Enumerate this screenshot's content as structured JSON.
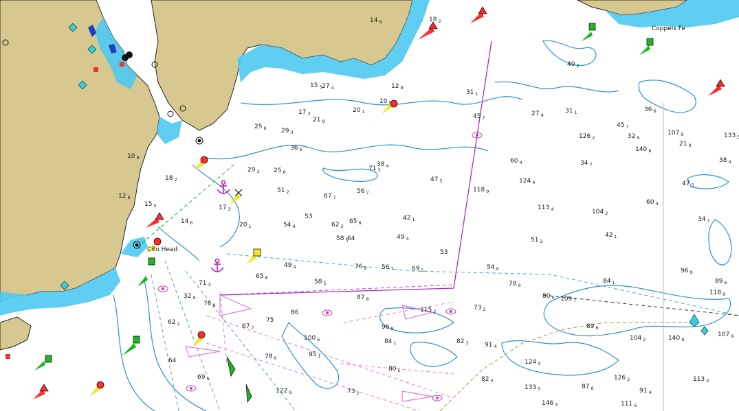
{
  "chart": {
    "place_names": [
      "Cito Head",
      "Coppeis Fe"
    ],
    "colors": {
      "land": "#d7c88f",
      "shallow_water": "#4fc9f2",
      "deep_water": "#ffffff",
      "depth_contour": "#2f8fd6",
      "traffic_lane": "#e07be0",
      "route_line": "#a020c0",
      "cable_line": "#4aa0d8",
      "boundary_line": "#d08030",
      "light_red": "#ff2a2a",
      "light_green": "#1fb81f",
      "light_yellow": "#f4e62a",
      "anchorage": "#c020c0"
    },
    "icons": [
      "anchor-icon",
      "light-flare-icon",
      "buoy-green-icon",
      "buoy-red-icon",
      "buoy-yellow-icon",
      "wreck-icon",
      "radar-beacon-icon"
    ],
    "soundings": [
      {
        "d": "27",
        "s": "4"
      },
      {
        "d": "31",
        "s": "1"
      },
      {
        "d": "45",
        "s": "7"
      },
      {
        "d": "36",
        "s": "6"
      },
      {
        "d": "21",
        "s": "9"
      },
      {
        "d": "38",
        "s": "4"
      },
      {
        "d": "47",
        "s": "5"
      },
      {
        "d": "60",
        "s": "4"
      },
      {
        "d": "34",
        "s": "7"
      },
      {
        "d": "42",
        "s": "1"
      },
      {
        "d": "51",
        "s": "2"
      },
      {
        "d": "54",
        "s": "9"
      },
      {
        "d": "53",
        "s": ""
      },
      {
        "d": "56",
        "s": "7"
      },
      {
        "d": "58",
        "s": "5"
      },
      {
        "d": "49",
        "s": "4"
      },
      {
        "d": "65",
        "s": "8"
      },
      {
        "d": "71",
        "s": "3"
      },
      {
        "d": "76",
        "s": "8"
      },
      {
        "d": "67",
        "s": "7"
      },
      {
        "d": "62",
        "s": "2"
      },
      {
        "d": "64",
        "s": ""
      },
      {
        "d": "69",
        "s": "5"
      },
      {
        "d": "78",
        "s": "6"
      },
      {
        "d": "73",
        "s": "2"
      },
      {
        "d": "80",
        "s": "5"
      },
      {
        "d": "82",
        "s": "3"
      },
      {
        "d": "87",
        "s": "8"
      },
      {
        "d": "91",
        "s": "4"
      },
      {
        "d": "89",
        "s": "6"
      },
      {
        "d": "84",
        "s": "1"
      },
      {
        "d": "96",
        "s": "9"
      },
      {
        "d": "104",
        "s": "2"
      },
      {
        "d": "113",
        "s": "4"
      },
      {
        "d": "118",
        "s": "9"
      },
      {
        "d": "124",
        "s": "4"
      },
      {
        "d": "126",
        "s": "2"
      },
      {
        "d": "140",
        "s": "8"
      },
      {
        "d": "107",
        "s": "9"
      },
      {
        "d": "133",
        "s": "5"
      },
      {
        "d": "29",
        "s": "3"
      },
      {
        "d": "25",
        "s": "6"
      },
      {
        "d": "17",
        "s": "3"
      },
      {
        "d": "20",
        "s": "1"
      },
      {
        "d": "14",
        "s": "6"
      },
      {
        "d": "18",
        "s": "2"
      },
      {
        "d": "10",
        "s": "9"
      },
      {
        "d": "12",
        "s": "8"
      },
      {
        "d": "15",
        "s": "5"
      },
      {
        "d": "32",
        "s": "9"
      },
      {
        "d": "40",
        "s": "2"
      },
      {
        "d": "86",
        "s": ""
      },
      {
        "d": "75",
        "s": ""
      },
      {
        "d": "95",
        "s": "1"
      },
      {
        "d": "109",
        "s": "7"
      },
      {
        "d": "115",
        "s": "2"
      },
      {
        "d": "122",
        "s": "9"
      },
      {
        "d": "100",
        "s": "6"
      },
      {
        "d": "146",
        "s": "3"
      },
      {
        "d": "111",
        "s": "6"
      }
    ]
  }
}
